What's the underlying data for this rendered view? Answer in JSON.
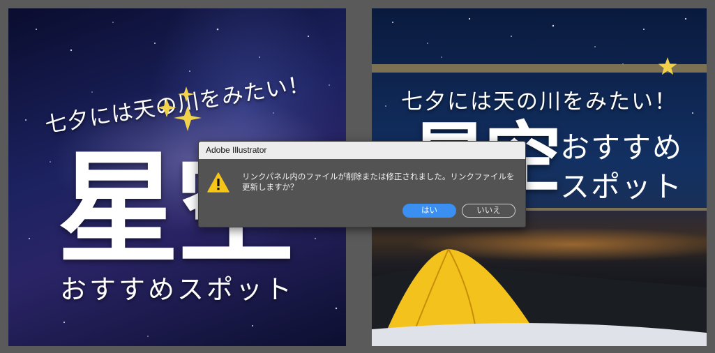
{
  "colors": {
    "canvas": "#5a5a5a",
    "star_gold": "#f2d24a",
    "dialog_bg": "#535353",
    "primary_button": "#3a8ff0",
    "warning_yellow": "#f5c518"
  },
  "left_artboard": {
    "subtitle": "七夕には天の川をみたい！",
    "big_title": "星空",
    "bottom_text": "おすすめスポット",
    "decoration_icon": "sparkle-stars-icon"
  },
  "right_artboard": {
    "subtitle": "七夕には天の川をみたい！",
    "big_title": "星空",
    "title_line1": "おすすめ",
    "title_line2": "スポット",
    "decoration_icon": "star-icon",
    "photo": "illuminated-tent-photo"
  },
  "dialog": {
    "title": "Adobe Illustrator",
    "icon": "warning-icon",
    "message": "リンクパネル内のファイルが削除または修正されました。リンクファイルを更新しますか？",
    "yes_label": "はい",
    "no_label": "いいえ"
  }
}
